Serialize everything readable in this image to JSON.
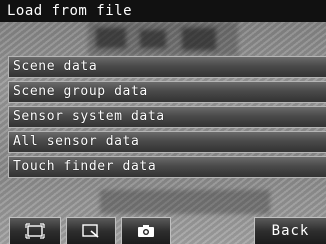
{
  "header": {
    "title": "Load from file"
  },
  "menu": {
    "items": [
      {
        "label": "Scene data"
      },
      {
        "label": "Scene group data"
      },
      {
        "label": "Sensor system data"
      },
      {
        "label": "All sensor data"
      },
      {
        "label": "Touch finder data"
      }
    ]
  },
  "toolbar": {
    "icons": [
      "window-frame-icon",
      "zoom-window-icon",
      "camera-icon"
    ],
    "back_label": "Back"
  }
}
